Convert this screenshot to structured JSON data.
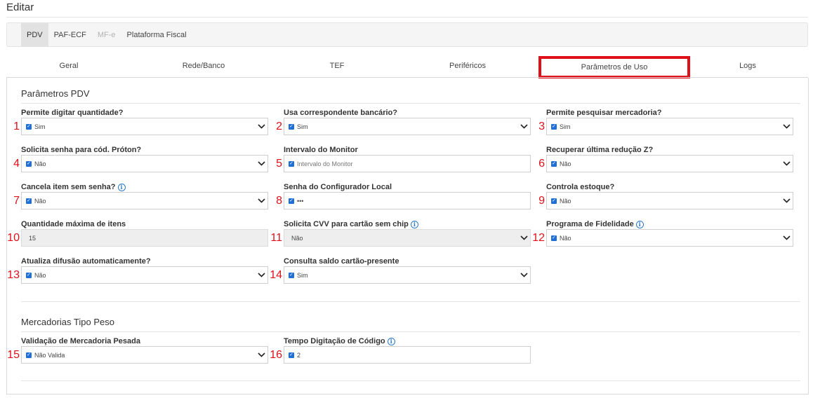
{
  "page": {
    "title": "Editar"
  },
  "top_tabs": [
    {
      "label": "PDV",
      "state": "active"
    },
    {
      "label": "PAF-ECF",
      "state": "normal"
    },
    {
      "label": "MF-e",
      "state": "disabled"
    },
    {
      "label": "Plataforma Fiscal",
      "state": "normal"
    }
  ],
  "sub_tabs": [
    {
      "label": "Geral"
    },
    {
      "label": "Rede/Banco"
    },
    {
      "label": "TEF"
    },
    {
      "label": "Periféricos"
    },
    {
      "label": "Parâmetros de Uso",
      "highlighted": true
    },
    {
      "label": "Logs"
    }
  ],
  "section_pdv": {
    "title": "Parâmetros PDV",
    "fields": [
      {
        "num": "1",
        "label": "Permite digitar quantidade?",
        "value": "Sim",
        "type": "select",
        "checked": true
      },
      {
        "num": "2",
        "label": "Usa correspondente bancário?",
        "value": "Sim",
        "type": "select",
        "checked": true
      },
      {
        "num": "3",
        "label": "Permite pesquisar mercadoria?",
        "value": "Sim",
        "type": "select",
        "checked": true
      },
      {
        "num": "4",
        "label": "Solicita senha para cód. Próton?",
        "value": "Não",
        "type": "select",
        "checked": true
      },
      {
        "num": "5",
        "label": "Intervalo do Monitor",
        "value": "",
        "placeholder": "Intervalo do Monitor",
        "type": "input",
        "checked": true
      },
      {
        "num": "6",
        "label": "Recuperar última redução Z?",
        "value": "Não",
        "type": "select",
        "checked": true
      },
      {
        "num": "7",
        "label": "Cancela item sem senha?",
        "info": true,
        "value": "Não",
        "type": "select",
        "checked": true
      },
      {
        "num": "8",
        "label": "Senha do Configurador Local",
        "value": "•••",
        "type": "input",
        "checked": true
      },
      {
        "num": "9",
        "label": "Controla estoque?",
        "value": "Não",
        "type": "select",
        "checked": true
      },
      {
        "num": "10",
        "label": "Quantidade máxima de itens",
        "value": "15",
        "type": "readonly",
        "checked": false
      },
      {
        "num": "11",
        "label": "Solicita CVV para cartão sem chip",
        "info": true,
        "value": "Não",
        "type": "readonly-select",
        "checked": false
      },
      {
        "num": "12",
        "label": "Programa de Fidelidade",
        "info": true,
        "value": "Não",
        "type": "select",
        "checked": true
      },
      {
        "num": "13",
        "label": "Atualiza difusão automaticamente?",
        "value": "Não",
        "type": "select",
        "checked": true
      },
      {
        "num": "14",
        "label": "Consulta saldo cartão-presente",
        "value": "Sim",
        "type": "select",
        "checked": true
      }
    ]
  },
  "section_peso": {
    "title": "Mercadorias Tipo Peso",
    "fields": [
      {
        "num": "15",
        "label": "Validação de Mercadoria Pesada",
        "value": "Não Valida",
        "type": "select",
        "checked": true
      },
      {
        "num": "16",
        "label": "Tempo Digitação de Código",
        "info": true,
        "value": "2",
        "type": "input",
        "checked": true
      }
    ]
  },
  "colors": {
    "highlight_red": "#e0101a",
    "checkbox_blue": "#1f6fd6",
    "info_blue": "#2a78c5"
  }
}
